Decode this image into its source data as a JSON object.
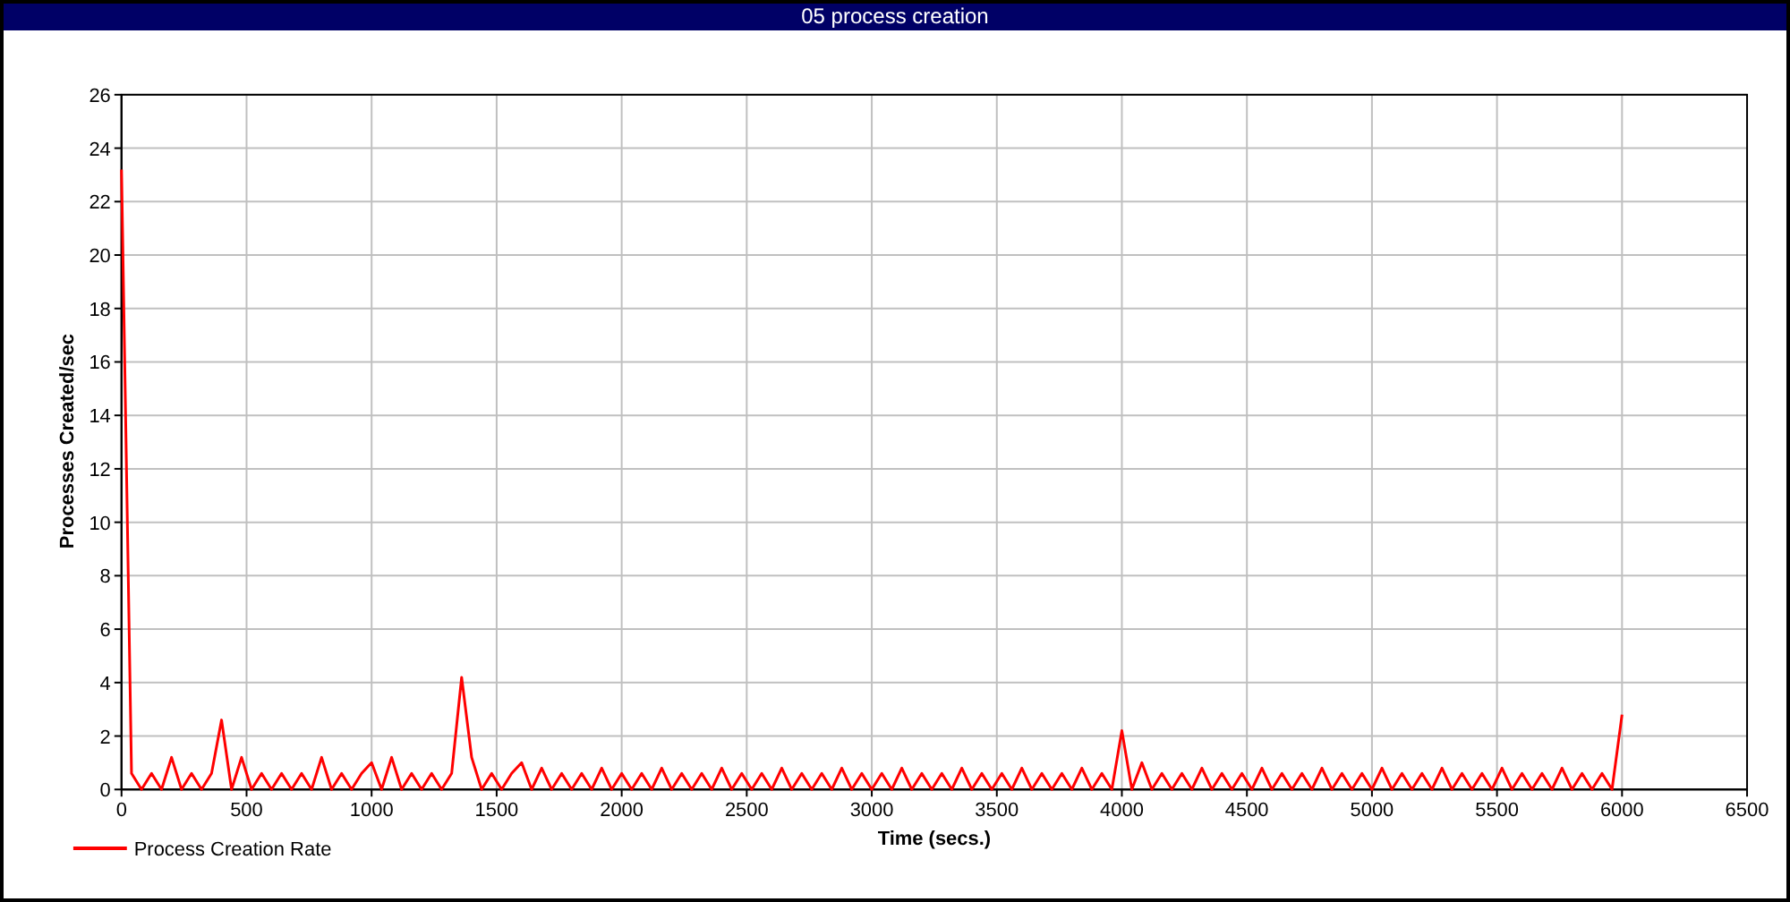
{
  "window": {
    "title": "05 process creation"
  },
  "chart": {
    "chart_data": {
      "type": "line",
      "xlabel": "Time (secs.)",
      "ylabel": "Processes Created/sec",
      "x": [
        0,
        40,
        80,
        120,
        160,
        200,
        240,
        280,
        320,
        360,
        400,
        440,
        480,
        520,
        560,
        600,
        640,
        680,
        720,
        760,
        800,
        840,
        880,
        920,
        960,
        1000,
        1040,
        1080,
        1120,
        1160,
        1200,
        1240,
        1280,
        1320,
        1360,
        1400,
        1440,
        1480,
        1520,
        1560,
        1600,
        1640,
        1680,
        1720,
        1760,
        1800,
        1840,
        1880,
        1920,
        1960,
        2000,
        2040,
        2080,
        2120,
        2160,
        2200,
        2240,
        2280,
        2320,
        2360,
        2400,
        2440,
        2480,
        2520,
        2560,
        2600,
        2640,
        2680,
        2720,
        2760,
        2800,
        2840,
        2880,
        2920,
        2960,
        3000,
        3040,
        3080,
        3120,
        3160,
        3200,
        3240,
        3280,
        3320,
        3360,
        3400,
        3440,
        3480,
        3520,
        3560,
        3600,
        3640,
        3680,
        3720,
        3760,
        3800,
        3840,
        3880,
        3920,
        3960,
        4000,
        4040,
        4080,
        4120,
        4160,
        4200,
        4240,
        4280,
        4320,
        4360,
        4400,
        4440,
        4480,
        4520,
        4560,
        4600,
        4640,
        4680,
        4720,
        4760,
        4800,
        4840,
        4880,
        4920,
        4960,
        5000,
        5040,
        5080,
        5120,
        5160,
        5200,
        5240,
        5280,
        5320,
        5360,
        5400,
        5440,
        5480,
        5520,
        5560,
        5600,
        5640,
        5680,
        5720,
        5760,
        5800,
        5840,
        5880,
        5920,
        5960,
        6000
      ],
      "series": [
        {
          "name": "Process Creation Rate",
          "color": "#ff0000",
          "values": [
            23.2,
            0.6,
            0,
            0.6,
            0,
            1.2,
            0,
            0.6,
            0,
            0.6,
            2.6,
            0,
            1.2,
            0,
            0.6,
            0,
            0.6,
            0,
            0.6,
            0,
            1.2,
            0,
            0.6,
            0,
            0.6,
            1,
            0,
            1.2,
            0,
            0.6,
            0,
            0.6,
            0,
            0.6,
            4.2,
            1.2,
            0,
            0.6,
            0,
            0.6,
            1,
            0,
            0.8,
            0,
            0.6,
            0,
            0.6,
            0,
            0.8,
            0,
            0.6,
            0,
            0.6,
            0,
            0.8,
            0,
            0.6,
            0,
            0.6,
            0,
            0.8,
            0,
            0.6,
            0,
            0.6,
            0,
            0.8,
            0,
            0.6,
            0,
            0.6,
            0,
            0.8,
            0,
            0.6,
            0,
            0.6,
            0,
            0.8,
            0,
            0.6,
            0,
            0.6,
            0,
            0.8,
            0,
            0.6,
            0,
            0.6,
            0,
            0.8,
            0,
            0.6,
            0,
            0.6,
            0,
            0.8,
            0,
            0.6,
            0,
            2.2,
            0,
            1,
            0,
            0.6,
            0,
            0.6,
            0,
            0.8,
            0,
            0.6,
            0,
            0.6,
            0,
            0.8,
            0,
            0.6,
            0,
            0.6,
            0,
            0.8,
            0,
            0.6,
            0,
            0.6,
            0,
            0.8,
            0,
            0.6,
            0,
            0.6,
            0,
            0.8,
            0,
            0.6,
            0,
            0.6,
            0,
            0.8,
            0,
            0.6,
            0,
            0.6,
            0,
            0.8,
            0,
            0.6,
            0,
            0.6,
            0,
            2.8
          ]
        }
      ],
      "xlim": [
        0,
        6500
      ],
      "ylim": [
        0,
        26
      ],
      "grid": true,
      "xticks": [
        0,
        500,
        1000,
        1500,
        2000,
        2500,
        3000,
        3500,
        4000,
        4500,
        5000,
        5500,
        6000,
        6500
      ],
      "yticks": [
        0,
        2,
        4,
        6,
        8,
        10,
        12,
        14,
        16,
        18,
        20,
        22,
        24,
        26
      ]
    }
  }
}
